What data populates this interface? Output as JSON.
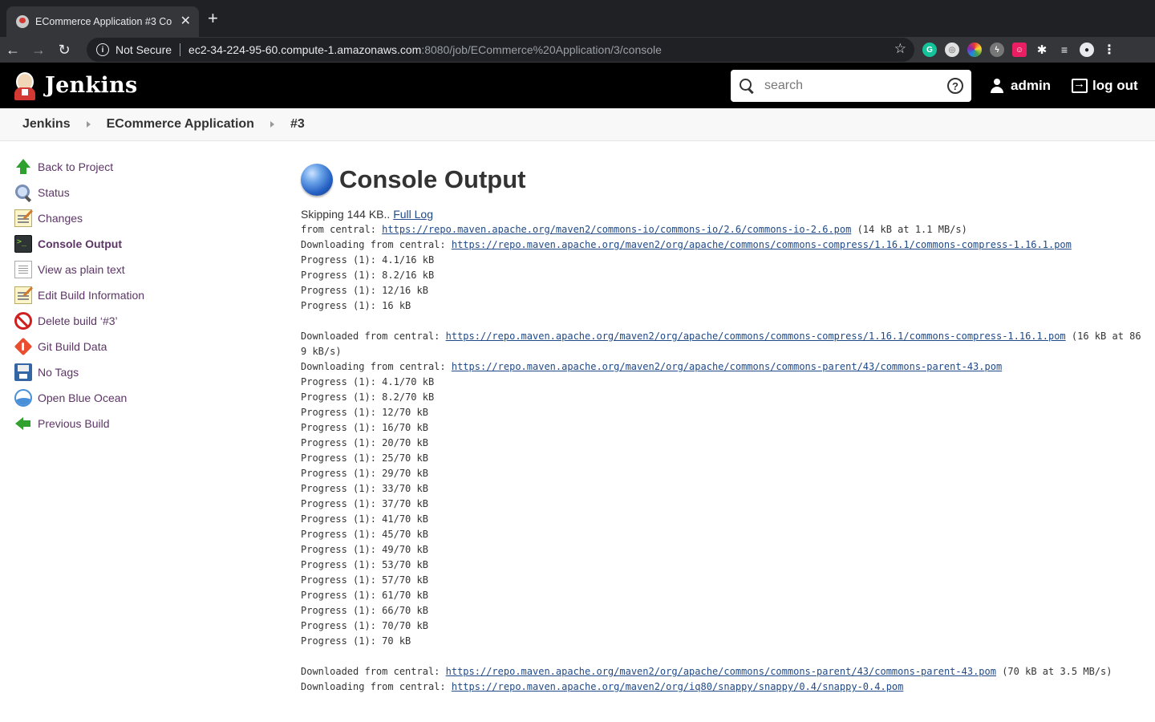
{
  "browser": {
    "tab_title": "ECommerce Application #3 Co",
    "not_secure": "Not Secure",
    "url_host": "ec2-34-224-95-60.compute-1.amazonaws.com",
    "url_rest": ":8080/job/ECommerce%20Application/3/console"
  },
  "header": {
    "brand": "Jenkins",
    "search_placeholder": "search",
    "user": "admin",
    "logout": "log out"
  },
  "breadcrumb": [
    "Jenkins",
    "ECommerce Application",
    "#3"
  ],
  "sidebar": {
    "items": [
      {
        "label": "Back to Project",
        "icon": "up-arrow-icon"
      },
      {
        "label": "Status",
        "icon": "magnifier-icon"
      },
      {
        "label": "Changes",
        "icon": "notepad-icon"
      },
      {
        "label": "Console Output",
        "icon": "terminal-icon"
      },
      {
        "label": "View as plain text",
        "icon": "document-icon"
      },
      {
        "label": "Edit Build Information",
        "icon": "notepad-icon"
      },
      {
        "label": "Delete build ‘#3’",
        "icon": "delete-icon"
      },
      {
        "label": "Git Build Data",
        "icon": "git-icon"
      },
      {
        "label": "No Tags",
        "icon": "tag-icon"
      },
      {
        "label": "Open Blue Ocean",
        "icon": "blue-ocean-icon"
      },
      {
        "label": "Previous Build",
        "icon": "back-arrow-icon"
      }
    ]
  },
  "main": {
    "title": "Console Output",
    "skipping_prefix": "Skipping 144 KB.. ",
    "full_log": "Full Log",
    "lines": [
      {
        "pre": "from central: ",
        "link": "https://repo.maven.apache.org/maven2/commons-io/commons-io/2.6/commons-io-2.6.pom",
        "post": " (14 kB at 1.1 MB/s)"
      },
      {
        "pre": "Downloading from central: ",
        "link": "https://repo.maven.apache.org/maven2/org/apache/commons/commons-compress/1.16.1/commons-compress-1.16.1.pom",
        "post": ""
      },
      {
        "pre": "Progress (1): 4.1/16 kB"
      },
      {
        "pre": "Progress (1): 8.2/16 kB"
      },
      {
        "pre": "Progress (1): 12/16 kB"
      },
      {
        "pre": "Progress (1): 16 kB"
      },
      {
        "pre": ""
      },
      {
        "pre": "Downloaded from central: ",
        "link": "https://repo.maven.apache.org/maven2/org/apache/commons/commons-compress/1.16.1/commons-compress-1.16.1.pom",
        "post": " (16 kB at 869 kB/s)"
      },
      {
        "pre": "Downloading from central: ",
        "link": "https://repo.maven.apache.org/maven2/org/apache/commons/commons-parent/43/commons-parent-43.pom",
        "post": ""
      },
      {
        "pre": "Progress (1): 4.1/70 kB"
      },
      {
        "pre": "Progress (1): 8.2/70 kB"
      },
      {
        "pre": "Progress (1): 12/70 kB"
      },
      {
        "pre": "Progress (1): 16/70 kB"
      },
      {
        "pre": "Progress (1): 20/70 kB"
      },
      {
        "pre": "Progress (1): 25/70 kB"
      },
      {
        "pre": "Progress (1): 29/70 kB"
      },
      {
        "pre": "Progress (1): 33/70 kB"
      },
      {
        "pre": "Progress (1): 37/70 kB"
      },
      {
        "pre": "Progress (1): 41/70 kB"
      },
      {
        "pre": "Progress (1): 45/70 kB"
      },
      {
        "pre": "Progress (1): 49/70 kB"
      },
      {
        "pre": "Progress (1): 53/70 kB"
      },
      {
        "pre": "Progress (1): 57/70 kB"
      },
      {
        "pre": "Progress (1): 61/70 kB"
      },
      {
        "pre": "Progress (1): 66/70 kB"
      },
      {
        "pre": "Progress (1): 70/70 kB"
      },
      {
        "pre": "Progress (1): 70 kB"
      },
      {
        "pre": ""
      },
      {
        "pre": "Downloaded from central: ",
        "link": "https://repo.maven.apache.org/maven2/org/apache/commons/commons-parent/43/commons-parent-43.pom",
        "post": " (70 kB at 3.5 MB/s)"
      },
      {
        "pre": "Downloading from central: ",
        "link": "https://repo.maven.apache.org/maven2/org/iq80/snappy/snappy/0.4/snappy-0.4.pom",
        "post": ""
      }
    ]
  }
}
